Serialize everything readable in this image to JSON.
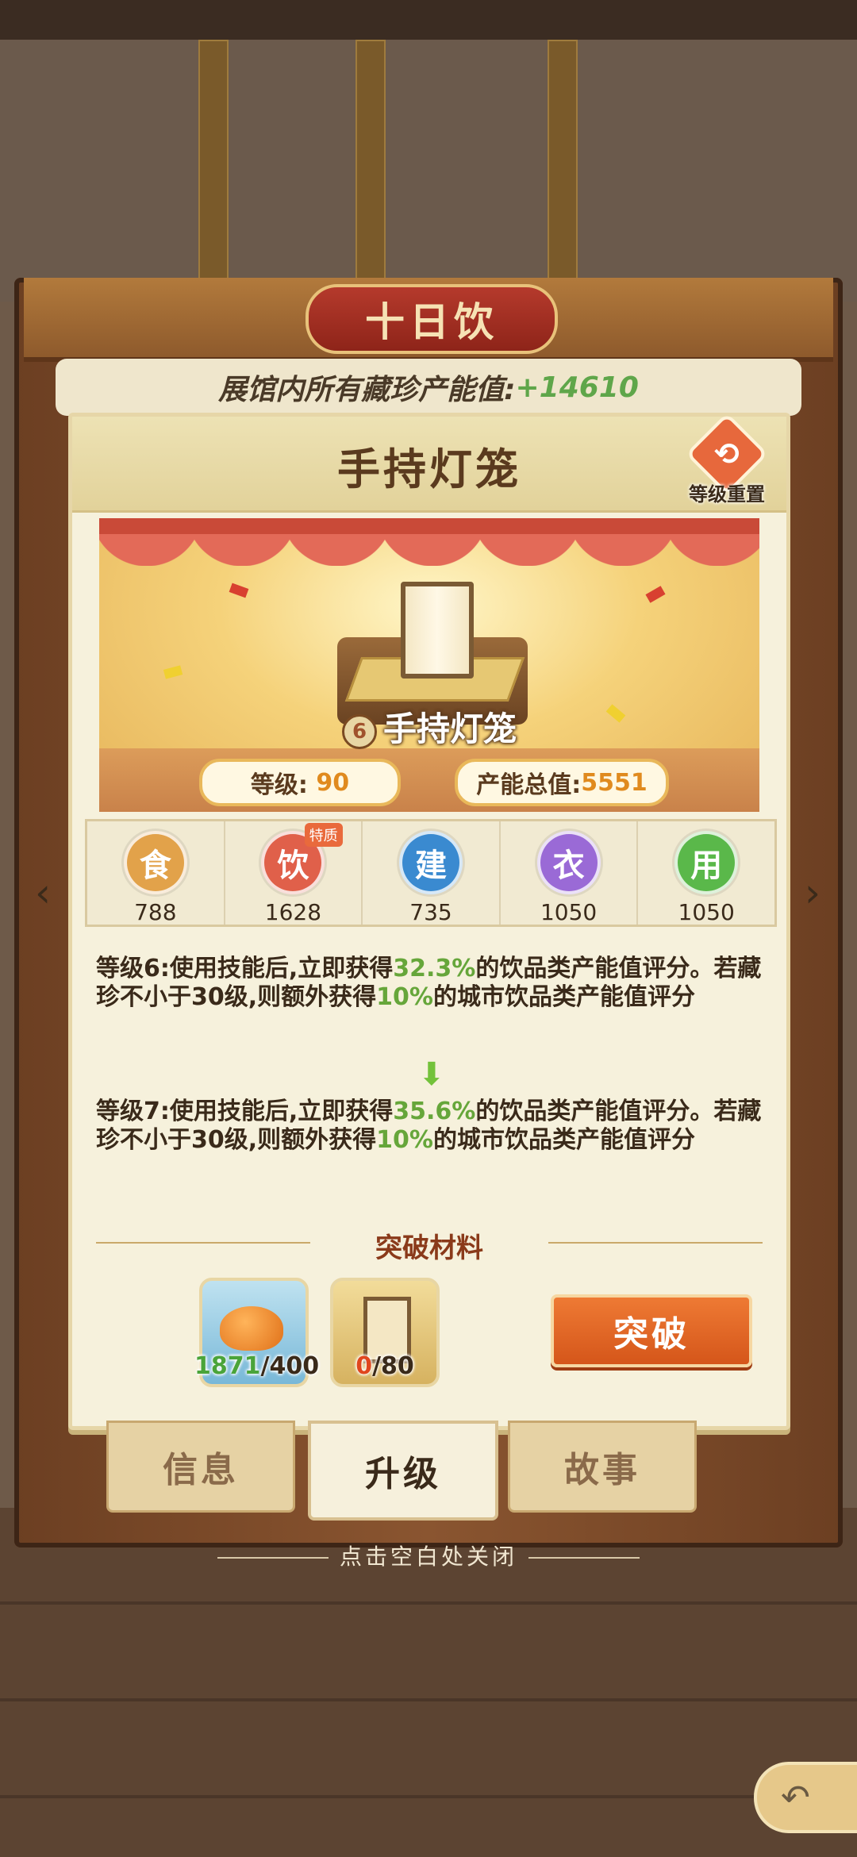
{
  "header": {
    "hall_title": "十日饮",
    "banner_label": "展馆内所有藏珍产能值:",
    "banner_value": "+14610"
  },
  "panel": {
    "title": "手持灯笼",
    "reset_label": "等级重置",
    "reset_icon": "refresh-icon"
  },
  "showcase": {
    "item_level_badge": "6",
    "item_name": "手持灯笼",
    "level_label": "等级:",
    "level_value": "90",
    "output_label": "产能总值:",
    "output_value": "5551"
  },
  "attributes": [
    {
      "glyph": "食",
      "value": "788",
      "color": "#e2a24a"
    },
    {
      "glyph": "饮",
      "value": "1628",
      "color": "#e0604a",
      "tag": "特质"
    },
    {
      "glyph": "建",
      "value": "735",
      "color": "#3a8ad0"
    },
    {
      "glyph": "衣",
      "value": "1050",
      "color": "#9a6ad6"
    },
    {
      "glyph": "用",
      "value": "1050",
      "color": "#5ab84a"
    }
  ],
  "skills": {
    "current": {
      "prefix": "等级6:使用技能后,立即获得",
      "pct1": "32.3%",
      "mid": "的饮品类产能值评分。若藏珍不小于30级,则额外获得",
      "pct2": "10%",
      "suffix": "的城市饮品类产能值评分"
    },
    "next": {
      "prefix": "等级7:使用技能后,立即获得",
      "pct1": "35.6%",
      "mid": "的饮品类产能值评分。若藏珍不小于30级,则额外获得",
      "pct2": "10%",
      "suffix": "的城市饮品类产能值评分"
    }
  },
  "materials": {
    "title": "突破材料",
    "items": [
      {
        "have": "1871",
        "need": "/400"
      },
      {
        "have": "0",
        "need": "/80"
      }
    ],
    "break_button": "突破"
  },
  "tabs": [
    {
      "label": "信息"
    },
    {
      "label": "升级"
    },
    {
      "label": "故事"
    }
  ],
  "close_hint": "点击空白处关闭"
}
